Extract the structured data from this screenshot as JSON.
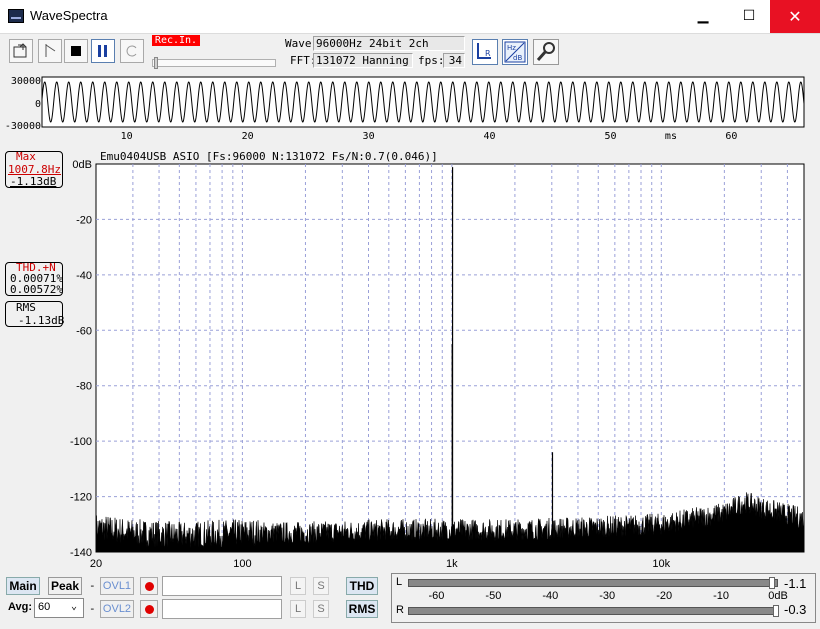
{
  "window": {
    "title": "WaveSpectra",
    "minimize": "▁",
    "maximize": "☐",
    "close": "✕"
  },
  "toolbar": {
    "rec_indicator": "Rec.In.",
    "wave_label": "Wave:",
    "wave_value": "96000Hz 24bit 2ch",
    "fft_label": "FFT:",
    "fft_value": "131072 Hanning",
    "fps_label": "fps:",
    "fps_value": "34",
    "progress": 0.02,
    "buttons": [
      "open-folder-icon",
      "play-icon",
      "stop-icon",
      "pause-icon",
      "loop-icon",
      "lr-channel-icon",
      "hz-db-icon",
      "settings-wrench-icon"
    ]
  },
  "waveform": {
    "y_ticks": [
      "30000",
      "0",
      "-30000"
    ],
    "x_ticks": [
      "10",
      "20",
      "30",
      "40",
      "50",
      "60"
    ],
    "x_unit": "ms",
    "amplitude": 30000,
    "frequency_hz": 1007.8,
    "x_range_ms": [
      3,
      66
    ],
    "color": "#000000"
  },
  "spectrum_header": "Emu0404USB ASIO  [Fs:96000 N:131072 Fs/N:0.7(0.046)]",
  "side": {
    "max_title": "Max",
    "max_freq": "1007.8Hz",
    "max_db": "-1.13dB",
    "thd_title": "THD.+N",
    "thd_1": "0.00071%",
    "thd_2": "0.00572%",
    "rms_title": "RMS",
    "rms_db": "-1.13dB",
    "max_color": "#cc0000"
  },
  "chart_data": {
    "type": "line",
    "title": "",
    "xscale": "log",
    "xlim": [
      20,
      48000
    ],
    "ylim": [
      -140,
      0
    ],
    "y_ticks": [
      "0dB",
      "-20",
      "-40",
      "-60",
      "-80",
      "-100",
      "-120",
      "-140"
    ],
    "x_ticks": [
      "20",
      "100",
      "1k",
      "10k"
    ],
    "grid": true,
    "peaks": [
      {
        "x": 1007.8,
        "y": -1.13
      },
      {
        "x": 1004,
        "y": -65
      },
      {
        "x": 3023,
        "y": -104
      }
    ],
    "noise_floor": [
      {
        "x": 20,
        "y": -131
      },
      {
        "x": 30,
        "y": -133
      },
      {
        "x": 50,
        "y": -134
      },
      {
        "x": 100,
        "y": -133
      },
      {
        "x": 200,
        "y": -133
      },
      {
        "x": 500,
        "y": -132
      },
      {
        "x": 1000,
        "y": -132
      },
      {
        "x": 2000,
        "y": -132
      },
      {
        "x": 5000,
        "y": -131
      },
      {
        "x": 10000,
        "y": -130
      },
      {
        "x": 20000,
        "y": -126
      },
      {
        "x": 25000,
        "y": -122
      },
      {
        "x": 30000,
        "y": -124
      },
      {
        "x": 48000,
        "y": -128
      }
    ],
    "colors": {
      "trace": "#000000",
      "grid": "#9aa0d8",
      "background": "#ffffff"
    }
  },
  "bottom": {
    "main": "Main",
    "peak": "Peak",
    "avg_label": "Avg:",
    "avg_value": "60",
    "ovl1": "OVL1",
    "ovl2": "OVL2",
    "l": "L",
    "s": "S",
    "thd": "THD",
    "rms": "RMS",
    "dash": "-"
  },
  "levels": {
    "l_label": "L",
    "r_label": "R",
    "l_value": "-1.1",
    "r_value": "-0.3",
    "scale": [
      "-60",
      "-50",
      "-40",
      "-30",
      "-20",
      "-10",
      "0dB"
    ],
    "l_level_db": -1.1,
    "r_level_db": -0.3
  }
}
